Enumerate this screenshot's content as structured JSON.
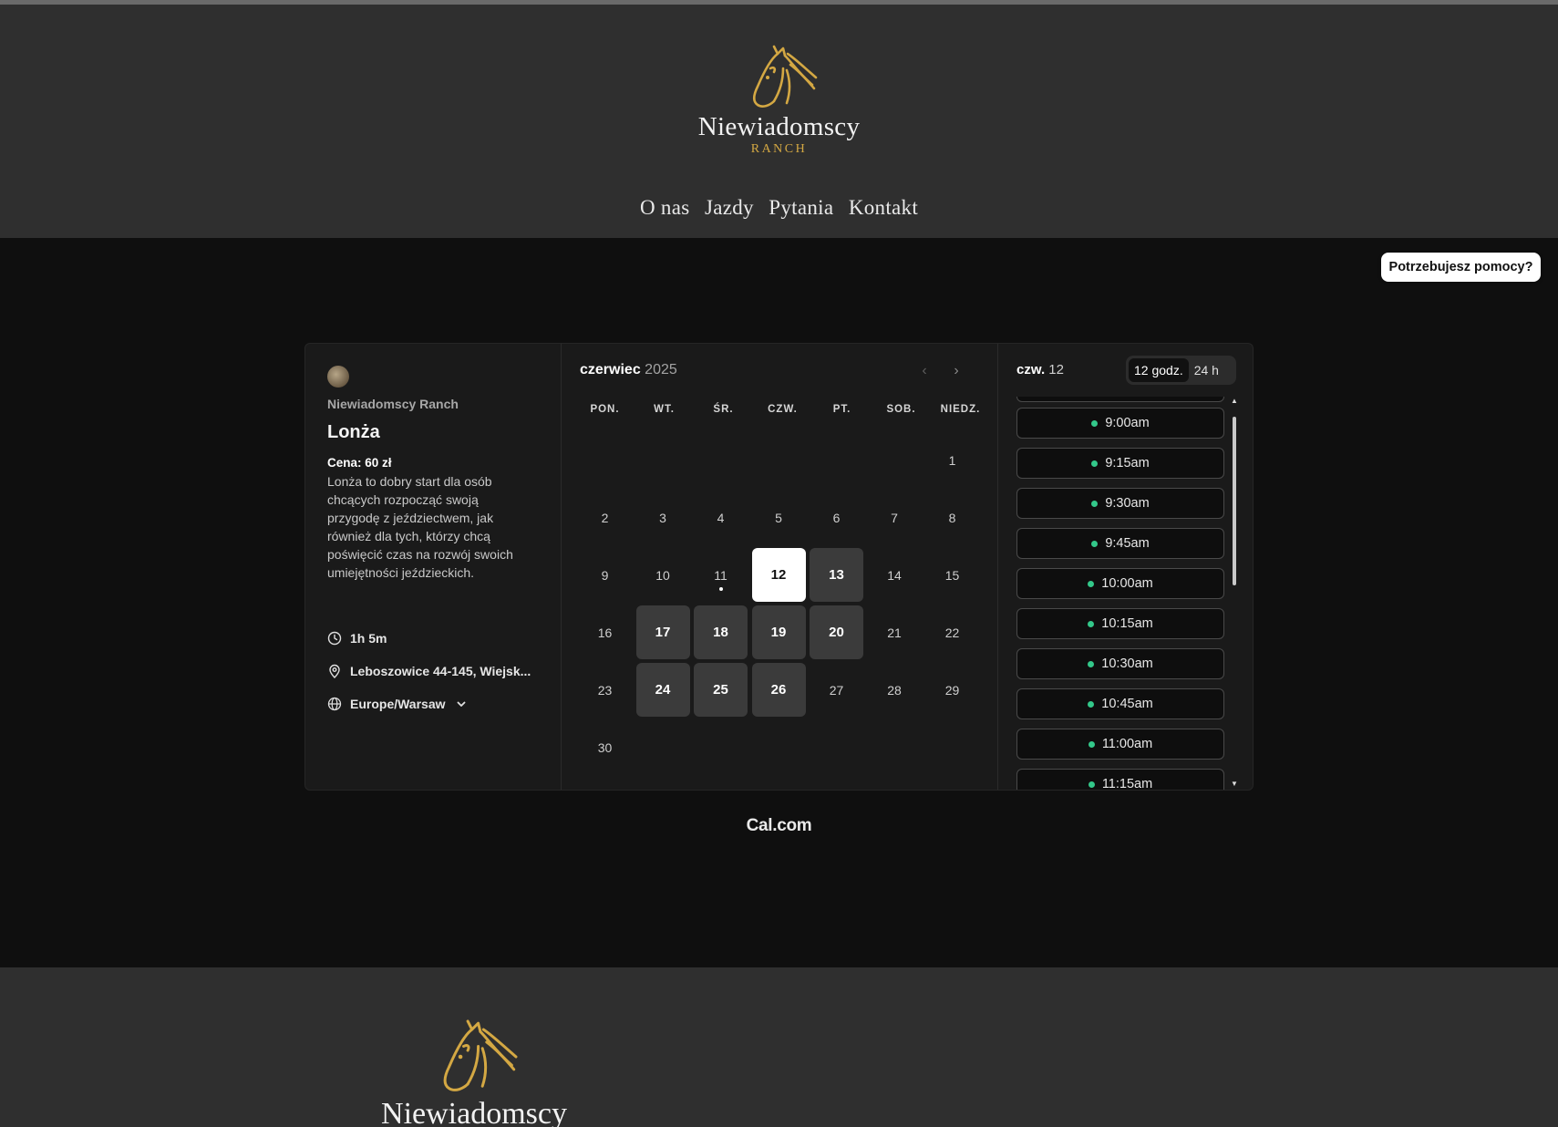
{
  "brand": {
    "name": "Niewiadomscy",
    "sub": "RANCH"
  },
  "nav": {
    "items": [
      "O nas",
      "Jazdy",
      "Pytania",
      "Kontakt"
    ]
  },
  "help_button": "Potrzebujesz pomocy?",
  "event": {
    "organizer": "Niewiadomscy Ranch",
    "title": "Lonża",
    "price": "Cena: 60 zł",
    "description": "Lonża to dobry start dla osób chcących rozpocząć swoją przygodę z jeździectwem, jak również dla tych, którzy chcą poświęcić czas na rozwój swoich umiejętności jeździeckich.",
    "duration": "1h 5m",
    "location": "Leboszowice 44-145, Wiejsk...",
    "timezone": "Europe/Warsaw"
  },
  "calendar": {
    "month": "czerwiec",
    "year": "2025",
    "weekdays": [
      "PON.",
      "WT.",
      "ŚR.",
      "CZW.",
      "PT.",
      "SOB.",
      "NIEDZ."
    ],
    "leading_blanks": 6,
    "days": [
      "1",
      "2",
      "3",
      "4",
      "5",
      "6",
      "7",
      "8",
      "9",
      "10",
      "11",
      "12",
      "13",
      "14",
      "15",
      "16",
      "17",
      "18",
      "19",
      "20",
      "21",
      "22",
      "23",
      "24",
      "25",
      "26",
      "27",
      "28",
      "29",
      "30"
    ],
    "available_days": [
      "12",
      "13",
      "17",
      "18",
      "19",
      "20",
      "24",
      "25",
      "26"
    ],
    "selected_day": "12",
    "today": "11"
  },
  "slots": {
    "selected_label": "czw.",
    "selected_num": "12",
    "format_12h": "12 godz.",
    "format_24h": "24 h",
    "times": [
      "9:00am",
      "9:15am",
      "9:30am",
      "9:45am",
      "10:00am",
      "10:15am",
      "10:30am",
      "10:45am",
      "11:00am",
      "11:15am"
    ],
    "available_color": "#33c88a"
  },
  "powered_by": "Cal.com",
  "colors": {
    "accent_gold": "#d4a843",
    "header_bg": "#2f2f2f",
    "page_bg": "#0f0f0f"
  }
}
